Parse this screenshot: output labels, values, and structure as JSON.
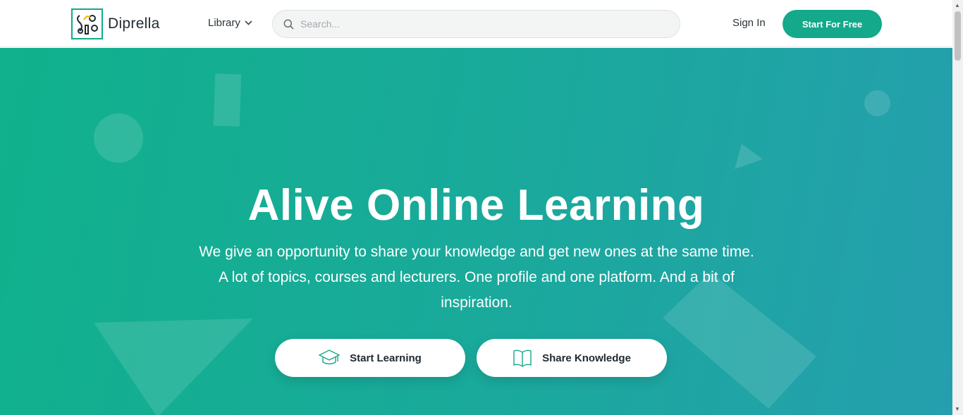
{
  "header": {
    "brand": "Diprella",
    "nav_library": "Library",
    "search_placeholder": "Search...",
    "sign_in": "Sign In",
    "cta": "Start For Free"
  },
  "hero": {
    "title": "Alive Online Learning",
    "subtitle": "We give an opportunity to share your knowledge and get new ones at the same time. A lot of topics, courses and lecturers. One profile and one platform. And a bit of inspiration.",
    "btn_learn": "Start Learning",
    "btn_share": "Share Knowledge"
  },
  "colors": {
    "brand_green": "#13a98a",
    "gradient_start": "#10b18c",
    "gradient_end": "#259fae"
  },
  "icons": {
    "search": "search-icon",
    "library_chevron": "chevron-down-icon",
    "learn": "graduation-cap-icon",
    "share": "open-book-icon"
  }
}
